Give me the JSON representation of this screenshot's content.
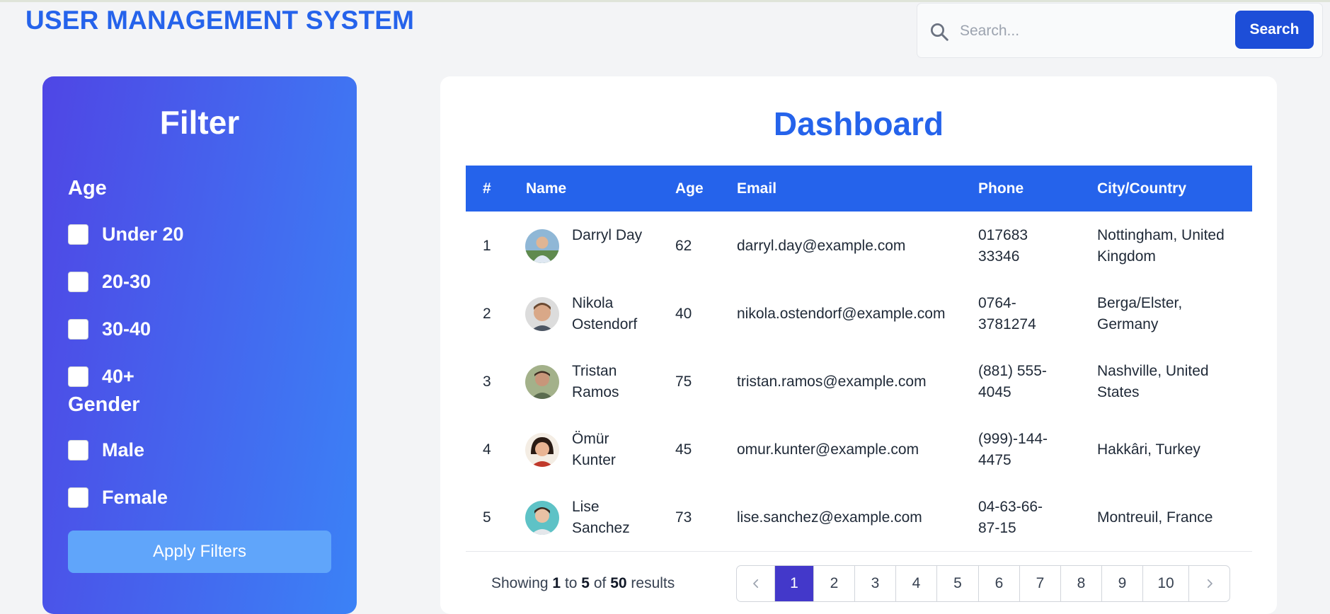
{
  "header": {
    "app_title": "USER MANAGEMENT SYSTEM",
    "search": {
      "placeholder": "Search...",
      "value": "",
      "button_label": "Search"
    }
  },
  "filter": {
    "title": "Filter",
    "age": {
      "title": "Age",
      "options": [
        "Under 20",
        "20-30",
        "30-40",
        "40+"
      ]
    },
    "gender": {
      "title": "Gender",
      "options": [
        "Male",
        "Female"
      ]
    },
    "apply_label": "Apply Filters"
  },
  "dashboard": {
    "title": "Dashboard",
    "columns": [
      "#",
      "Name",
      "Age",
      "Email",
      "Phone",
      "City/Country"
    ],
    "rows": [
      {
        "index": "1",
        "name_line1": "Darryl Day",
        "name_line2": "",
        "age": "62",
        "email": "darryl.day@example.com",
        "phone_line1": "017683",
        "phone_line2": "33346",
        "city_line1": "Nottingham, United",
        "city_line2": "Kingdom"
      },
      {
        "index": "2",
        "name_line1": "Nikola",
        "name_line2": "Ostendorf",
        "age": "40",
        "email": "nikola.ostendorf@example.com",
        "phone_line1": "0764-",
        "phone_line2": "3781274",
        "city_line1": "Berga/Elster,",
        "city_line2": "Germany"
      },
      {
        "index": "3",
        "name_line1": "Tristan",
        "name_line2": "Ramos",
        "age": "75",
        "email": "tristan.ramos@example.com",
        "phone_line1": "(881) 555-",
        "phone_line2": "4045",
        "city_line1": "Nashville, United",
        "city_line2": "States"
      },
      {
        "index": "4",
        "name_line1": "Ömür",
        "name_line2": "Kunter",
        "age": "45",
        "email": "omur.kunter@example.com",
        "phone_line1": "(999)-144-",
        "phone_line2": "4475",
        "city_line1": "Hakkâri, Turkey",
        "city_line2": ""
      },
      {
        "index": "5",
        "name_line1": "Lise",
        "name_line2": "Sanchez",
        "age": "73",
        "email": "lise.sanchez@example.com",
        "phone_line1": "04-63-66-",
        "phone_line2": "87-15",
        "city_line1": "Montreuil, France",
        "city_line2": ""
      }
    ],
    "results": {
      "prefix": "Showing",
      "from": "1",
      "to_word": "to",
      "to": "5",
      "of_word": "of",
      "total": "50",
      "suffix": "results"
    },
    "pagination": {
      "prev_icon": "chevron-left-icon",
      "next_icon": "chevron-right-icon",
      "pages": [
        "1",
        "2",
        "3",
        "4",
        "5",
        "6",
        "7",
        "8",
        "9",
        "10"
      ],
      "current": "1"
    }
  },
  "colors": {
    "brand": "#2563eb",
    "header_bg": "#2563eb",
    "panel_from": "#4f46e5",
    "panel_to": "#3b82f6",
    "apply_button": "#60a5fa",
    "search_button": "#1d4ed8",
    "active_page": "#4338ca"
  }
}
